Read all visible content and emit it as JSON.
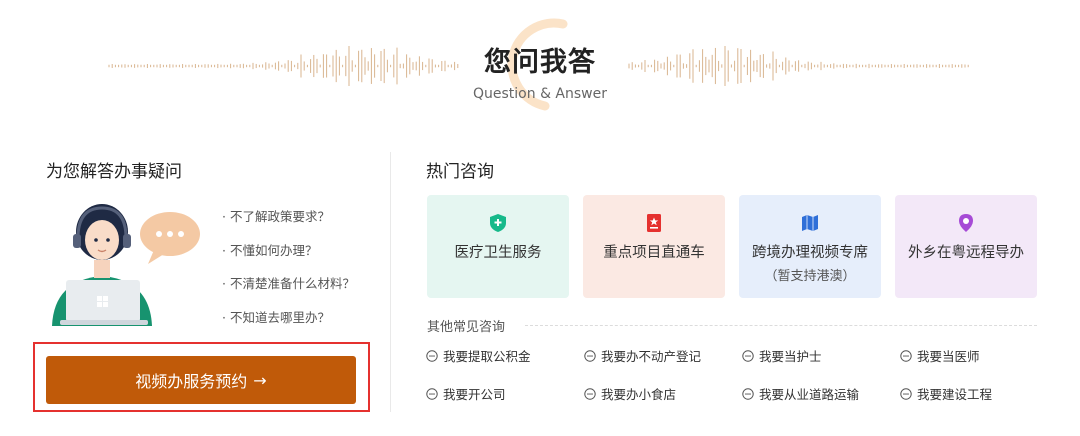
{
  "header": {
    "title": "您问我答",
    "subtitle": "Question & Answer"
  },
  "left": {
    "title": "为您解答办事疑问",
    "questions": [
      "· 不了解政策要求？",
      "· 不懂如何办理？",
      "· 不清楚准备什么材料？",
      "· 不知道去哪里办？"
    ],
    "cta_label": "视频办服务预约",
    "cta_arrow": "→"
  },
  "right": {
    "title": "热门咨询",
    "cards": [
      {
        "label": "医疗卫生服务",
        "icon": "shield-plus-icon",
        "color": "#16b98a"
      },
      {
        "label": "重点项目直通车",
        "icon": "bookmark-star-icon",
        "color": "#e5312f"
      },
      {
        "label": "跨境办理视频专席",
        "sub": "（暂支持港澳）",
        "icon": "map-icon",
        "color": "#2f6fd8"
      },
      {
        "label": "外乡在粤远程导办",
        "icon": "location-pin-icon",
        "color": "#a64ad6"
      }
    ],
    "other_title": "其他常见咨询",
    "links": [
      "我要提取公积金",
      "我要办不动产登记",
      "我要当护士",
      "我要当医师",
      "我要开公司",
      "我要办小食店",
      "我要从业道路运输",
      "我要建设工程"
    ]
  },
  "colors": {
    "cta": "#c05a09",
    "highlight_border": "#e5312f",
    "accent_ring": "#f5c28a"
  }
}
